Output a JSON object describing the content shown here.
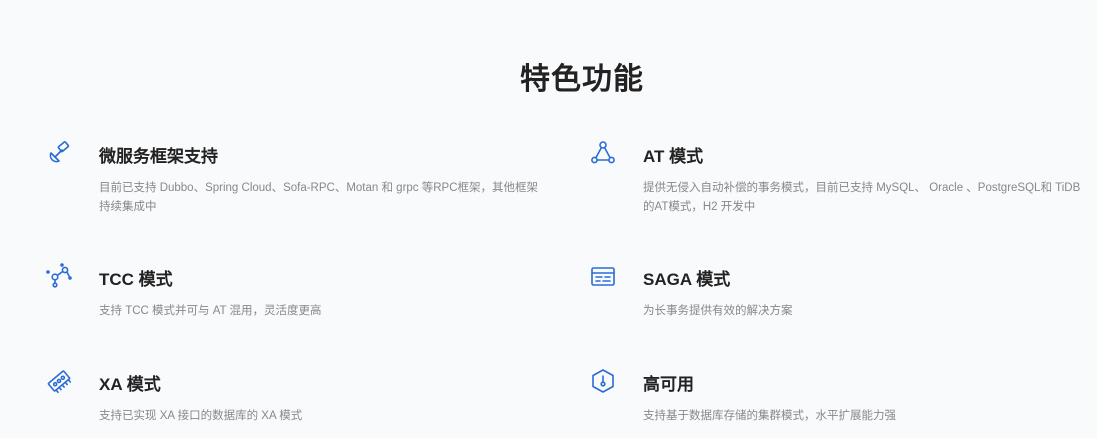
{
  "section": {
    "title": "特色功能"
  },
  "features": [
    {
      "title": "微服务框架支持",
      "desc": "目前已支持 Dubbo、Spring Cloud、Sofa-RPC、Motan 和 grpc 等RPC框架，其他框架持续集成中",
      "icon": "satellite-icon"
    },
    {
      "title": "AT 模式",
      "desc": "提供无侵入自动补偿的事务模式，目前已支持 MySQL、 Oracle 、PostgreSQL和 TiDB的AT模式，H2 开发中",
      "icon": "network-nodes-icon"
    },
    {
      "title": "TCC 模式",
      "desc": "支持 TCC 模式并可与 AT 混用，灵活度更高",
      "icon": "molecule-icon"
    },
    {
      "title": "SAGA 模式",
      "desc": "为长事务提供有效的解决方案",
      "icon": "browser-window-icon"
    },
    {
      "title": "XA 模式",
      "desc": "支持已实现 XA 接口的数据库的 XA 模式",
      "icon": "memory-chip-icon"
    },
    {
      "title": "高可用",
      "desc": "支持基于数据库存储的集群模式，水平扩展能力强",
      "icon": "hexagon-shield-icon"
    }
  ],
  "colors": {
    "icon": "#2b6cd4",
    "title": "#222222",
    "desc": "#888888",
    "background": "#f9fafb"
  }
}
